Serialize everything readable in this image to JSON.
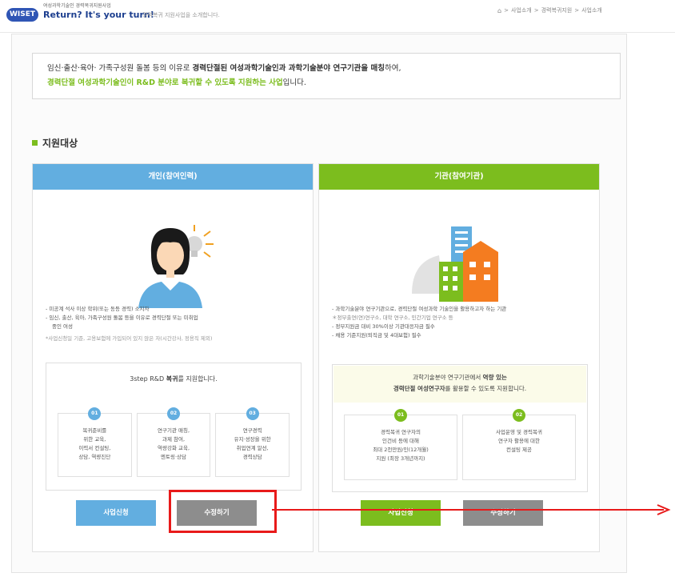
{
  "header": {
    "logo_text": "WISET",
    "brand_sub": "여성과학기술인 경력복귀지원사업",
    "brand_title": "Return? It's your turn!",
    "brand_desc": "경력복귀 지원사업을 소개합니다.",
    "breadcrumb": [
      "사업소개",
      "경력복귀지원",
      "사업소개"
    ]
  },
  "intro": {
    "line1_a": "임신·출산·육아· 가족구성원 돌봄 등의 이유로 ",
    "line1_b": "경력단절된 여성과학기술인과 과학기술분야 연구기관을 매칭",
    "line1_c": "하여,",
    "line2_green": "경력단절 여성과학기술인이 R&D 분야로 복귀할 수 있도록 지원하는 사업",
    "line2_tail": "입니다."
  },
  "section_title": "지원대상",
  "left_panel": {
    "header": "개인(참여인력)",
    "bullets": [
      "- 미공계 석사 이상 학위(또는 동등 경력) 소지자",
      "- 임신, 출산, 육아, 가족구성원 돌봄 등을 이유로 경력단절 또는 미취업",
      "  중인 여성"
    ],
    "note": "*사업신청일 기준, 고용보험에 가입되어 있지 않은 자(시간강사, 정용직 제외)",
    "box_title_plain": "3step R&D ",
    "box_title_bold": "복귀",
    "box_title_tail": "를 지원합니다.",
    "steps": [
      {
        "num": "01",
        "text": "복귀준비를\n위한 교육,\n이력서 컨설팅,\n상담, 역량진단"
      },
      {
        "num": "02",
        "text": "연구기관 매칭,\n과제 참여,\n역량강화 교육,\n멘토링·상담"
      },
      {
        "num": "03",
        "text": "연구경력\n유지·성장을 위한\n취업연계 알선,\n경력상담"
      }
    ],
    "apply_label": "사업신청",
    "edit_label": "수정하기"
  },
  "right_panel": {
    "header": "기관(참여기관)",
    "bullets": [
      "- 과학기술분야 연구기관으로, 경력단절 여성과학 기술인을 활용하고자 하는 기관",
      "  ＊정부출연(연)연구소, 대학 연구소, 민간기업 연구소 등",
      "- 정부지원금 대비 30%이상 기관대응자금 필수",
      "- 채용 기준지원(퇴직금 및 4대보험) 필수"
    ],
    "highlight_line1_plain": "과학기술분야 연구기관에서 ",
    "highlight_line1_bold": "역량 있는",
    "highlight_line2_bold": "경력단절 여성연구자",
    "highlight_line2_tail": "를 활용할 수 있도록 지원합니다.",
    "steps": [
      {
        "num": "01",
        "text": "경력복귀 연구자의\n인건비 등에 대해\n최대 2천만원/인(12개월)\n지원 (최장 3개년까지)"
      },
      {
        "num": "02",
        "text": "사업운영 및 경력복귀\n연구자 활용에 대한\n컨설팅 제공"
      }
    ],
    "apply_label": "사업신청",
    "edit_label": "수정하기"
  },
  "colors": {
    "blue": "#62aee0",
    "green": "#7cbd1e",
    "gray_button": "#8d8d8d",
    "highlight_red": "#e81a1a"
  }
}
